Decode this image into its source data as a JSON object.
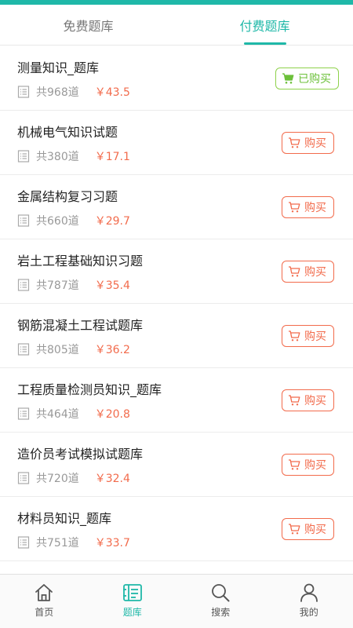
{
  "tabs": [
    {
      "label": "免费题库",
      "active": false
    },
    {
      "label": "付费题库",
      "active": true
    }
  ],
  "items": [
    {
      "title": "测量知识_题库",
      "count": "共968道",
      "price": "￥43.5",
      "button": "已购买",
      "bought": true
    },
    {
      "title": "机械电气知识试题",
      "count": "共380道",
      "price": "￥17.1",
      "button": "购买",
      "bought": false
    },
    {
      "title": "金属结构复习习题",
      "count": "共660道",
      "price": "￥29.7",
      "button": "购买",
      "bought": false
    },
    {
      "title": "岩土工程基础知识习题",
      "count": "共787道",
      "price": "￥35.4",
      "button": "购买",
      "bought": false
    },
    {
      "title": "钢筋混凝土工程试题库",
      "count": "共805道",
      "price": "￥36.2",
      "button": "购买",
      "bought": false
    },
    {
      "title": "工程质量检测员知识_题库",
      "count": "共464道",
      "price": "￥20.8",
      "button": "购买",
      "bought": false
    },
    {
      "title": "造价员考试模拟试题库",
      "count": "共720道",
      "price": "￥32.4",
      "button": "购买",
      "bought": false
    },
    {
      "title": "材料员知识_题库",
      "count": "共751道",
      "price": "￥33.7",
      "button": "购买",
      "bought": false
    }
  ],
  "nav": [
    {
      "label": "首页",
      "icon": "home-icon"
    },
    {
      "label": "题库",
      "icon": "question-bank-icon",
      "active": true
    },
    {
      "label": "搜索",
      "icon": "search-icon"
    },
    {
      "label": "我的",
      "icon": "user-icon"
    }
  ],
  "colors": {
    "accent": "#1fb8a8",
    "price": "#f26b4c",
    "bought": "#6cc03a"
  }
}
